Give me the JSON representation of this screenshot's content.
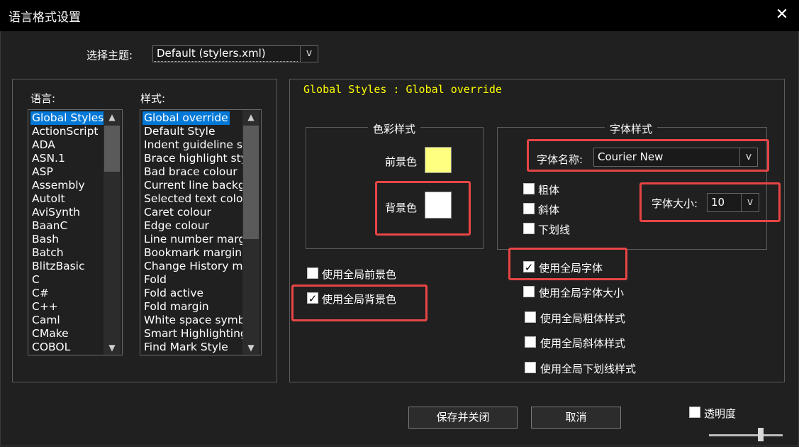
{
  "window": {
    "title": "语言格式设置",
    "close_glyph": "✕"
  },
  "theme": {
    "label": "选择主题:",
    "value": "Default (stylers.xml)",
    "arrow": "v"
  },
  "languages": {
    "label": "语言:",
    "selected_index": 0,
    "items": [
      "Global Styles",
      "ActionScript",
      "ADA",
      "ASN.1",
      "ASP",
      "Assembly",
      "AutoIt",
      "AviSynth",
      "BaanC",
      "Bash",
      "Batch",
      "BlitzBasic",
      "C",
      "C#",
      "C++",
      "Caml",
      "CMake",
      "COBOL"
    ],
    "scroll_position": 0.0
  },
  "styles": {
    "label": "样式:",
    "selected_index": 0,
    "items": [
      "Global override",
      "Default Style",
      "Indent guideline sty",
      "Brace highlight style",
      "Bad brace colour",
      "Current line backgro",
      "Selected text colour",
      "Caret colour",
      "Edge colour",
      "Line number margin",
      "Bookmark margin",
      "Change History mar",
      "Fold",
      "Fold active",
      "Fold margin",
      "White space symbol",
      "Smart Highlighting",
      "Find Mark Style"
    ],
    "scroll_position": 0.0
  },
  "group_title": "Global Styles : Global override",
  "color_style": {
    "legend": "色彩样式",
    "foreground_label": "前景色",
    "foreground_color": "#ffff80",
    "background_label": "背景色",
    "background_color": "#ffffff"
  },
  "font_style": {
    "legend": "字体样式",
    "font_name_label": "字体名称:",
    "font_name_value": "Courier New",
    "font_size_label": "字体大小:",
    "font_size_value": "10",
    "bold_label": "粗体",
    "bold_checked": false,
    "italic_label": "斜体",
    "italic_checked": false,
    "underline_label": "下划线",
    "underline_checked": false,
    "combo_arrow": "v"
  },
  "global_options": {
    "use_global_fg_label": "使用全局前景色",
    "use_global_fg_checked": false,
    "use_global_bg_label": "使用全局背景色",
    "use_global_bg_checked": true,
    "use_global_font_label": "使用全局字体",
    "use_global_font_checked": true,
    "use_global_font_size_label": "使用全局字体大小",
    "use_global_font_size_checked": false,
    "use_global_bold_label": "使用全局粗体样式",
    "use_global_bold_checked": false,
    "use_global_italic_label": "使用全局斜体样式",
    "use_global_italic_checked": false,
    "use_global_underline_label": "使用全局下划线样式",
    "use_global_underline_checked": false
  },
  "buttons": {
    "save_close": "保存并关闭",
    "cancel": "取消"
  },
  "transparency": {
    "label": "透明度",
    "checked": false,
    "level": 0.7
  },
  "check_glyph": "✓",
  "highlight_color": "#e84545"
}
